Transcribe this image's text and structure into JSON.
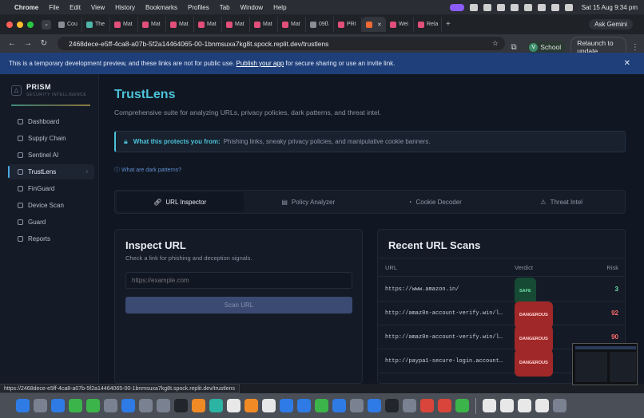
{
  "menubar": {
    "app": "Chrome",
    "items": [
      "File",
      "Edit",
      "View",
      "History",
      "Bookmarks",
      "Profiles",
      "Tab",
      "Window",
      "Help"
    ],
    "clock": "Sat 15 Aug  9:34 pm"
  },
  "tabs": [
    {
      "label": "Cou",
      "icon": "tab-favicon"
    },
    {
      "label": "The",
      "icon": "tab-favicon"
    },
    {
      "label": "Mat",
      "icon": "tab-favicon"
    },
    {
      "label": "Mat",
      "icon": "tab-favicon"
    },
    {
      "label": "Mat",
      "icon": "tab-favicon"
    },
    {
      "label": "Mat",
      "icon": "tab-favicon"
    },
    {
      "label": "Mat",
      "icon": "tab-favicon"
    },
    {
      "label": "Mat",
      "icon": "tab-favicon"
    },
    {
      "label": "Mat",
      "icon": "tab-favicon"
    },
    {
      "label": "09ß",
      "icon": "tab-favicon"
    },
    {
      "label": "PRI",
      "icon": "tab-favicon"
    },
    {
      "label": "",
      "icon": "tab-favicon"
    },
    {
      "label": "Wei",
      "icon": "tab-favicon"
    },
    {
      "label": "Rela",
      "icon": "tab-favicon"
    }
  ],
  "browser": {
    "ask_gemini": "Ask Gemini",
    "url": "2468dece-e5ff-4ca8-a07b-5f2a14464065-00-1bnmsuxa7kg8t.spock.replit.dev/trustlens",
    "profile_initial": "V",
    "profile_name": "School",
    "relaunch": "Relaunch to update"
  },
  "banner": {
    "text_before": "This is a temporary development preview, and these links are not for public use. ",
    "link": "Publish your app",
    "text_after": " for secure sharing or use an invite link."
  },
  "sidebar": {
    "brand": "PRISM",
    "tagline": "SECURITY INTELLIGENCE",
    "items": [
      {
        "label": "Dashboard"
      },
      {
        "label": "Supply Chain"
      },
      {
        "label": "Sentinel AI"
      },
      {
        "label": "TrustLens"
      },
      {
        "label": "FinGuard"
      },
      {
        "label": "Device Scan"
      },
      {
        "label": "Guard"
      },
      {
        "label": "Reports"
      }
    ],
    "active": "TrustLens"
  },
  "main": {
    "title": "TrustLens",
    "subtitle": "Comprehensive suite for analyzing URLs, privacy policies, dark patterns, and threat intel.",
    "protect_label": "What this protects you from:",
    "protect_text": "Phishing links, sneaky privacy policies, and manipulative cookie banners.",
    "dark_link": "What are dark patterns?",
    "tabs": [
      {
        "label": "URL Inspector"
      },
      {
        "label": "Policy Analyzer"
      },
      {
        "label": "Cookie Decoder"
      },
      {
        "label": "Threat Intel"
      }
    ],
    "inspect": {
      "title": "Inspect URL",
      "desc": "Check a link for phishing and deception signals.",
      "placeholder": "https://example.com",
      "button": "Scan URL"
    },
    "recent": {
      "title": "Recent URL Scans",
      "headers": [
        "URL",
        "Verdict",
        "Risk"
      ],
      "rows": [
        {
          "url": "https://www.amazon.in/",
          "verdict": "SAFE",
          "risk": "3"
        },
        {
          "url": "http://amaz0n-account-verify.win/lo…",
          "verdict": "DANGEROUS",
          "risk": "92"
        },
        {
          "url": "http://amaz0n-account-verify.win/lo…",
          "verdict": "DANGEROUS",
          "risk": "90"
        },
        {
          "url": "http://paypa1-secure-login.account-…",
          "verdict": "DANGEROUS",
          "risk": ""
        }
      ]
    }
  },
  "status_url": "https://2468dece-e5ff-4ca8-a07b-5f2a14464065-00-1bnmsuxa7kg8t.spock.replit.dev/trustlens",
  "colors": {
    "accent": "#4cc2d9",
    "safe": "#6fe0a6",
    "danger": "#a12828",
    "risk_danger": "#ff6b6b"
  }
}
